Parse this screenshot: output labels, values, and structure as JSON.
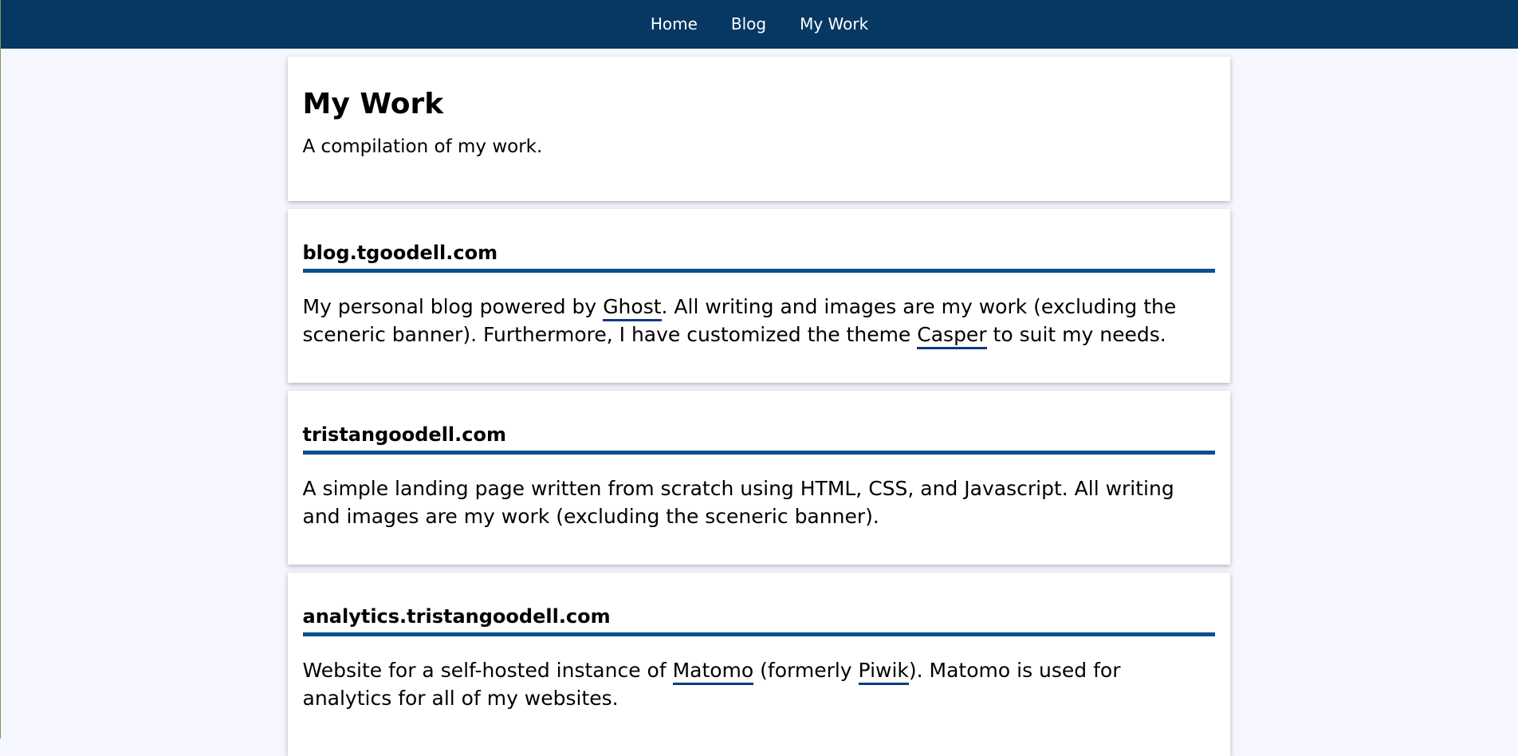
{
  "nav": {
    "items": [
      "Home",
      "Blog",
      "My Work"
    ]
  },
  "intro": {
    "title": "My Work",
    "text": "A compilation of my work."
  },
  "projects": [
    {
      "title": "blog.tgoodell.com",
      "desc": {
        "p1": "My personal blog powered by ",
        "link1": "Ghost",
        "p2": ". All writing and images are my work (excluding the sceneric banner). Furthermore, I have customized the theme ",
        "link2": "Casper",
        "p3": " to suit my needs."
      }
    },
    {
      "title": "tristangoodell.com",
      "desc": {
        "p1": "A simple landing page written from scratch using HTML, CSS, and Javascript. All writing and images are my work (excluding the sceneric banner)."
      }
    },
    {
      "title": "analytics.tristangoodell.com",
      "desc": {
        "p1": "Website for a self-hosted instance of ",
        "link1": "Matomo",
        "p2": " (formerly ",
        "link2": "Piwik",
        "p3": "). Matomo is used for analytics for all of my websites."
      }
    }
  ],
  "colors": {
    "nav_bg": "#073763",
    "page_bg": "#f6f6fe",
    "accent": "#0b4f92"
  }
}
